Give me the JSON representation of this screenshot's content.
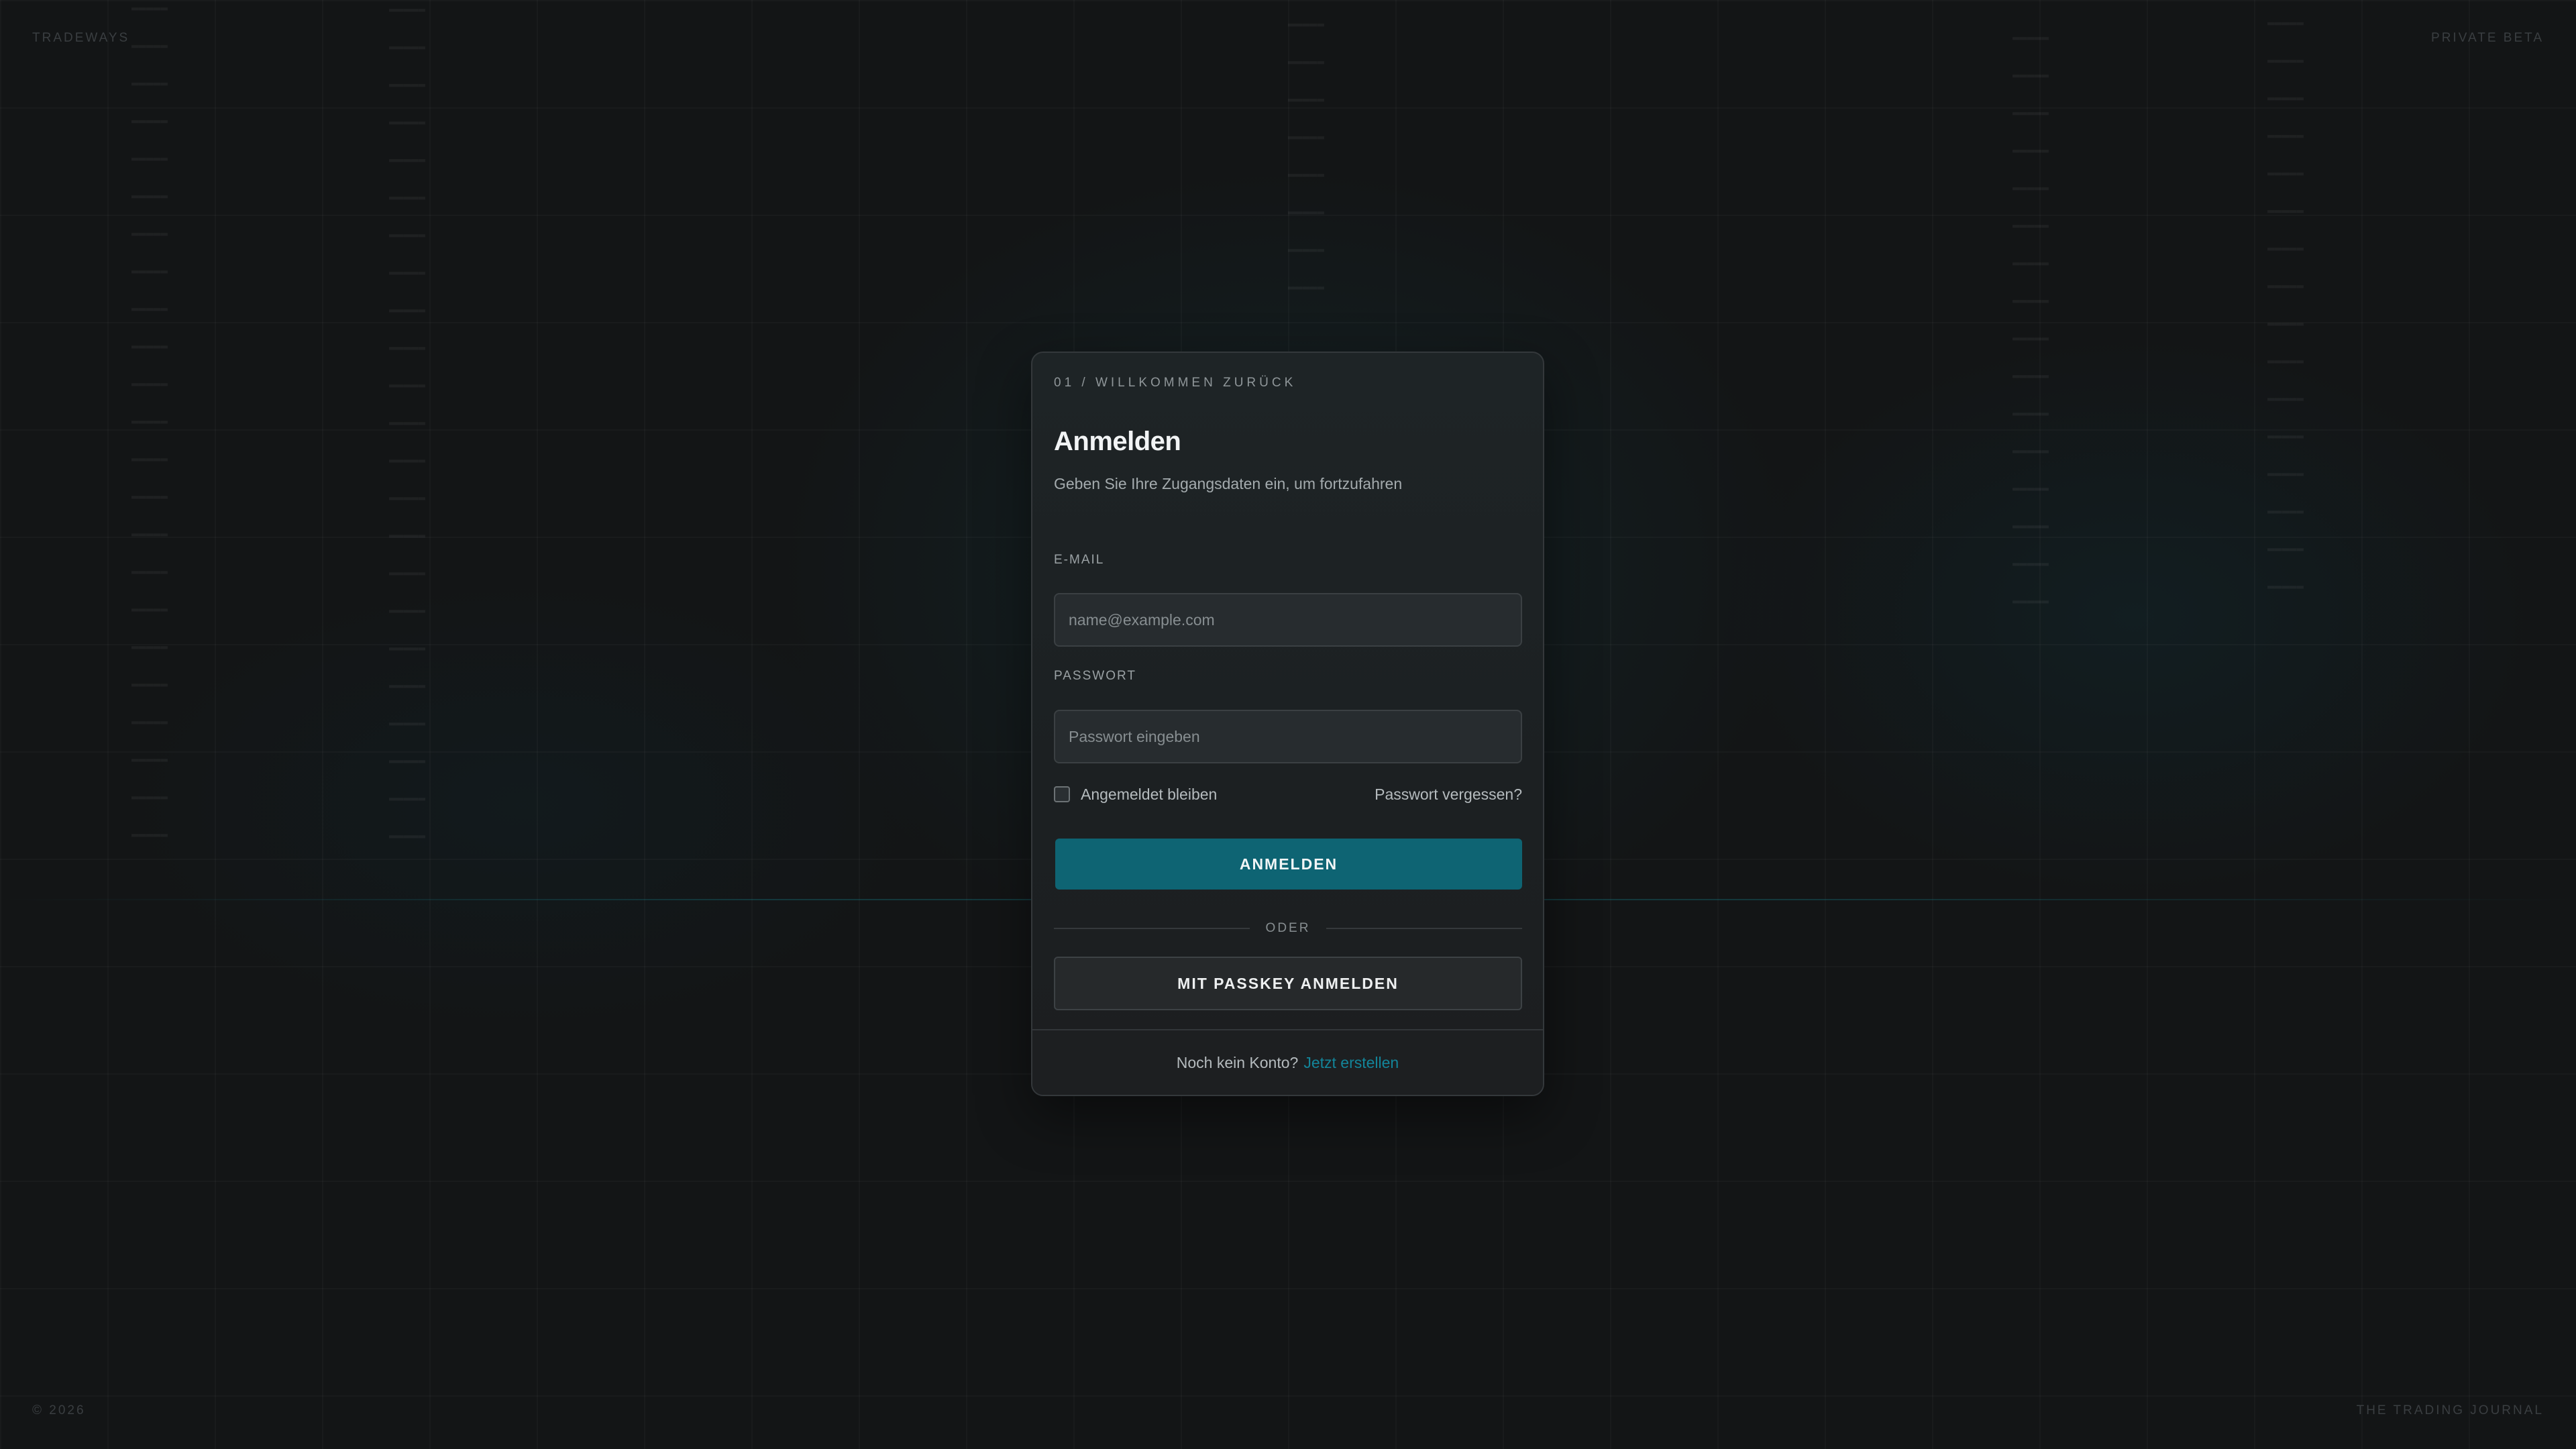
{
  "brand": "TRADEWAYS",
  "badge": "PRIVATE BETA",
  "footer_left": "© 2026",
  "footer_right": "THE TRADING JOURNAL",
  "colors": {
    "background": "#131516",
    "card": "#1e2426",
    "accent": "#0e6473",
    "link": "#13859a"
  },
  "login": {
    "eyebrow": "01 / WILLKOMMEN ZURÜCK",
    "title": "Anmelden",
    "subtitle": "Geben Sie Ihre Zugangsdaten ein, um fortzufahren",
    "email": {
      "label": "E-MAIL",
      "placeholder": "name@example.com",
      "value": ""
    },
    "password": {
      "label": "PASSWORT",
      "placeholder": "Passwort eingeben",
      "value": ""
    },
    "remember_label": "Angemeldet bleiben",
    "remember_checked": false,
    "forgot_label": "Passwort vergessen?",
    "submit_label": "ANMELDEN",
    "divider_label": "ODER",
    "passkey_label": "MIT PASSKEY ANMELDEN",
    "no_account_text": "Noch kein Konto?",
    "signup_label": "Jetzt erstellen"
  }
}
